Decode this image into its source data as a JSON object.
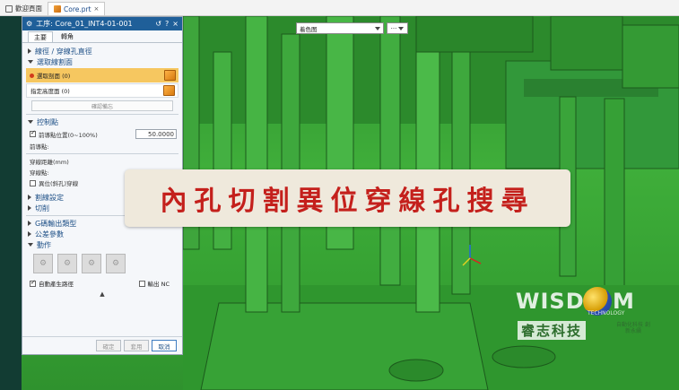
{
  "doc_tabs": [
    {
      "label": "歡迎頁面",
      "icon": "home-icon"
    },
    {
      "label": "Core.prt",
      "icon": "part-file-icon",
      "close": "×"
    }
  ],
  "view_select": {
    "value": "着色图",
    "more": "···"
  },
  "panel": {
    "title": "工序: Core_01_INT4-01-001",
    "header_icons": [
      "gear-icon",
      "refresh-icon",
      "help-icon",
      "close-icon"
    ],
    "help": "?",
    "close": "×",
    "tabs": [
      "主要",
      "轉角"
    ],
    "sec_wire": "線徑 / 穿線孔直徑",
    "sec_select": "選取線割面",
    "select_face": "選取剖面 (0)",
    "height_face": "指定高度面 (0)",
    "confirm": "確認備忘",
    "sec_control": "控制點",
    "lead_pos_label": "前導點位置(0~100%)",
    "lead_pos_value": "50.0000",
    "lead_start": "前導點:",
    "thread_dist": "穿線距離(mm)",
    "thread_point": "穿線點:",
    "offset_hole": "異位(斜孔)穿線",
    "sec_cut": "割線設定",
    "sec_cutting": "切削",
    "sec_gcode": "G碼輸出類型",
    "sec_tolerance": "公差參數",
    "sec_action": "動作",
    "auto_path": "自動產生路徑",
    "output_nc": "輸出 NC",
    "collapse": "▲",
    "btn_ok": "確定",
    "btn_apply": "套用",
    "btn_cancel": "取消"
  },
  "banner": {
    "text": "內孔切割異位穿線孔搜尋"
  },
  "logo": {
    "big_left": "WISD",
    "big_right": "M",
    "small": "TECHNOLOGY",
    "cn": "睿志科技",
    "cn2": "自動化科技 創新永續"
  },
  "colors": {
    "model_green": "#3fae3a",
    "panel_header": "#1f5f99",
    "highlight_row": "#f6c760",
    "banner_text": "#c4201c",
    "banner_bg": "#efe9dc"
  }
}
